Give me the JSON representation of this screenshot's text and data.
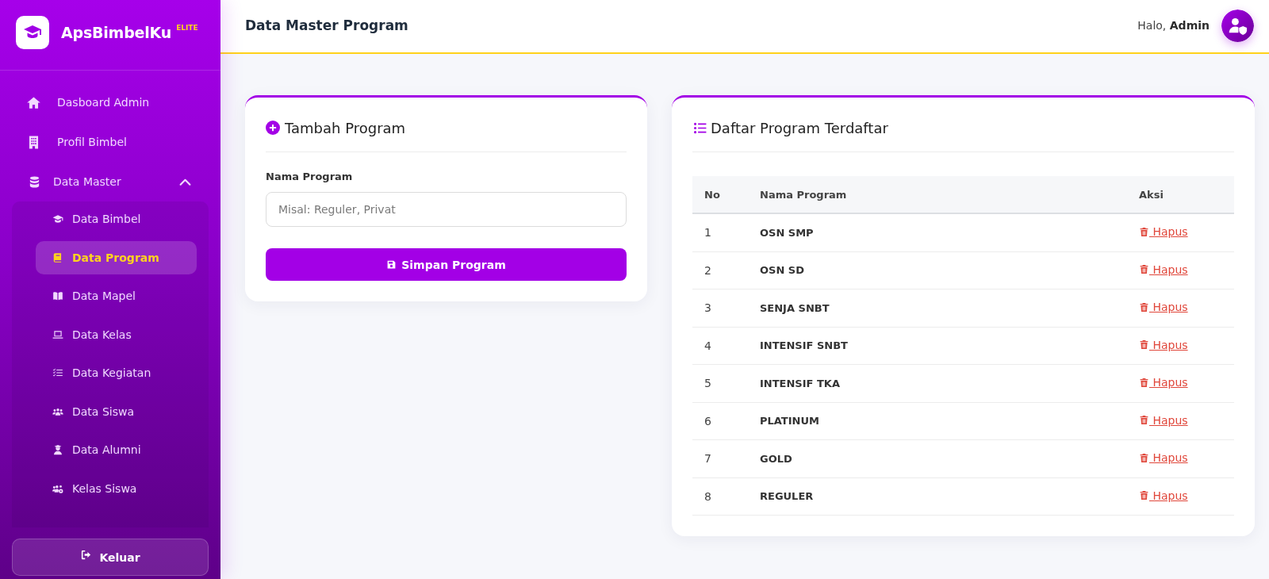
{
  "sidebar": {
    "brand": "ApsBimbelKu",
    "badge": "ELITE",
    "items": [
      {
        "kind": "link",
        "label": "Dasboard Admin",
        "selected": false
      },
      {
        "kind": "link",
        "label": "Profil Bimbel",
        "selected": false
      },
      {
        "kind": "group",
        "label": "Data Master",
        "expanded": true,
        "children": [
          {
            "label": "Data Bimbel",
            "selected": false
          },
          {
            "label": "Data Program",
            "selected": true
          },
          {
            "label": "Data Mapel",
            "selected": false
          },
          {
            "label": "Data Kelas",
            "selected": false
          },
          {
            "label": "Data Kegiatan",
            "selected": false
          },
          {
            "label": "Data Siswa",
            "selected": false
          },
          {
            "label": "Data Alumni",
            "selected": false
          },
          {
            "label": "Kelas Siswa",
            "selected": false
          }
        ]
      }
    ],
    "logout": "Keluar"
  },
  "header": {
    "title": "Data Master Program",
    "greeting": "Halo, **Admin**"
  },
  "form_card": {
    "title": "Tambah Program",
    "field_label": "Nama Program",
    "placeholder": "Misal: Reguler, Privat",
    "submit": "Simpan Program"
  },
  "list_card": {
    "title": "Daftar Program Terdaftar",
    "table": {
      "columns": [
        "No",
        "Nama Program",
        "Aksi"
      ],
      "rows": [
        {
          "no": "1",
          "name": "OSN SMP",
          "action": "Hapus"
        },
        {
          "no": "2",
          "name": "OSN SD",
          "action": "Hapus"
        },
        {
          "no": "3",
          "name": "SENJA SNBT",
          "action": "Hapus"
        },
        {
          "no": "4",
          "name": "INTENSIF SNBT",
          "action": "Hapus"
        },
        {
          "no": "5",
          "name": "INTENSIF TKA",
          "action": "Hapus"
        },
        {
          "no": "6",
          "name": "PLATINUM",
          "action": "Hapus"
        },
        {
          "no": "7",
          "name": "GOLD",
          "action": "Hapus"
        },
        {
          "no": "8",
          "name": "REGULER",
          "action": "Hapus"
        }
      ]
    }
  }
}
